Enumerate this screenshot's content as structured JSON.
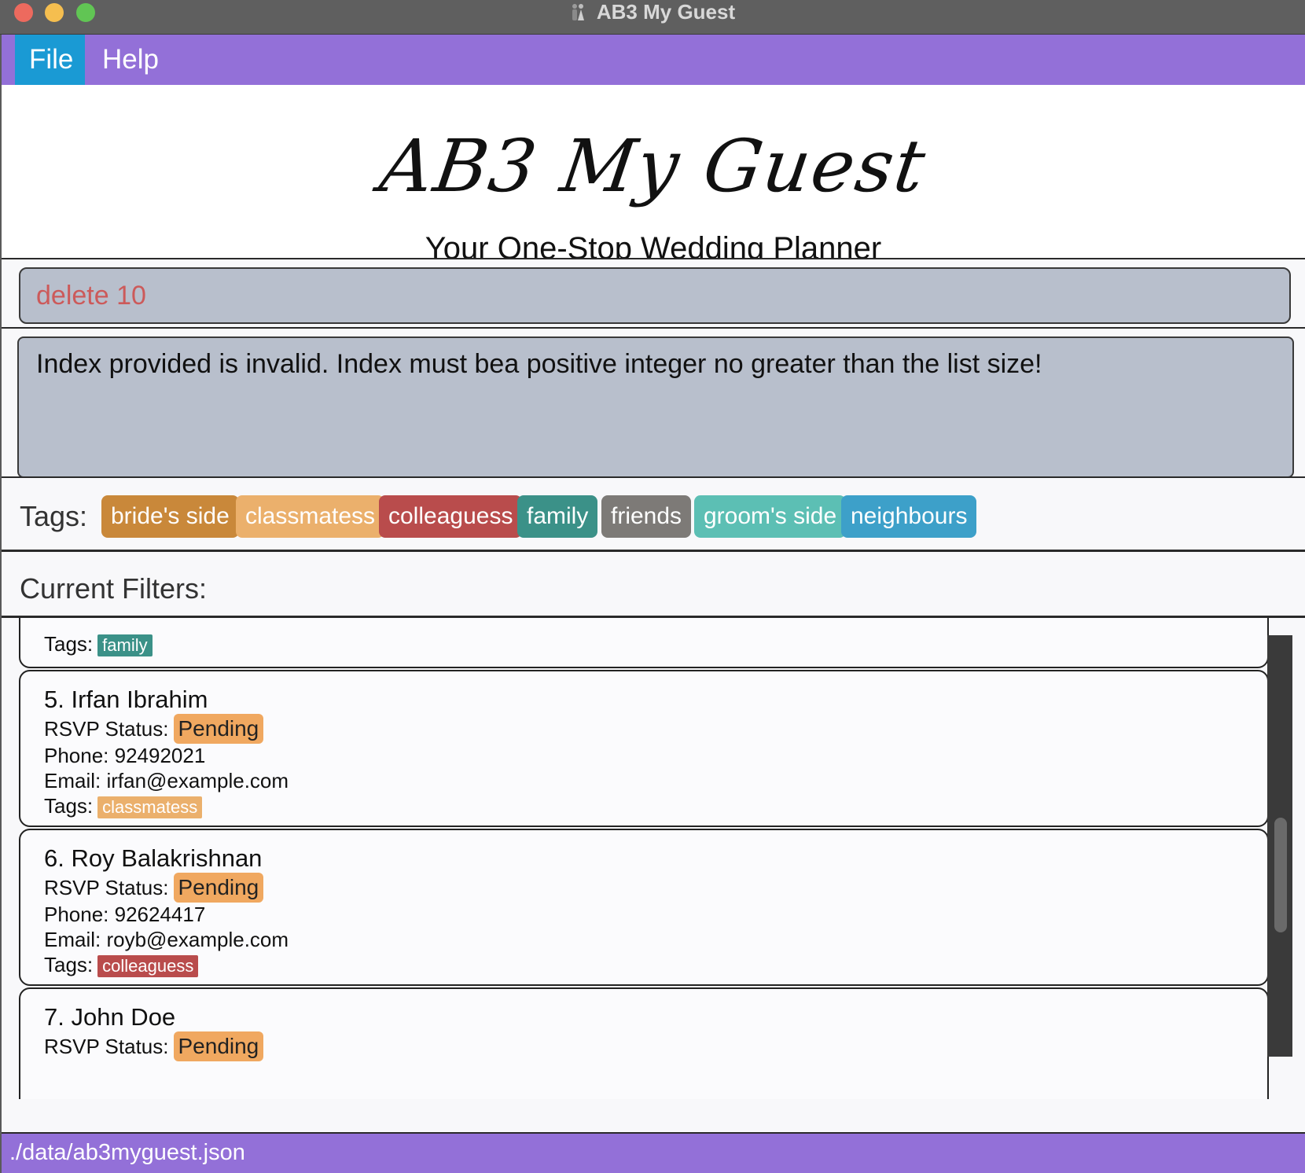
{
  "window": {
    "title": "AB3 My Guest"
  },
  "menu": {
    "file": "File",
    "help": "Help"
  },
  "header": {
    "logo": "AB3 My Guest",
    "subtitle": "Your One-Stop Wedding Planner"
  },
  "command": {
    "value": "delete 10"
  },
  "result": {
    "message": "Index provided is invalid. Index must bea positive integer no greater than the list size!"
  },
  "tags": {
    "label": "Tags:",
    "items": [
      {
        "label": "bride's side",
        "color": "#c9883a"
      },
      {
        "label": "classmatess",
        "color": "#ebb06c"
      },
      {
        "label": "colleaguess",
        "color": "#b94c4c"
      },
      {
        "label": "family",
        "color": "#3b9188"
      },
      {
        "label": "friends",
        "color": "#7d7a77"
      },
      {
        "label": "groom's side",
        "color": "#5cbfb4"
      },
      {
        "label": "neighbours",
        "color": "#3da0c9"
      }
    ]
  },
  "filters": {
    "label": "Current Filters:"
  },
  "guests": [
    {
      "tags_label": "Tags:",
      "tag": "family",
      "tag_color": "#3b9188"
    },
    {
      "name": "5. Irfan Ibrahim",
      "rsvp_label": "RSVP Status:",
      "rsvp": "Pending",
      "phone": "Phone: 92492021",
      "email": "Email: irfan@example.com",
      "tags_label": "Tags:",
      "tag": "classmatess",
      "tag_color": "#ebb06c"
    },
    {
      "name": "6. Roy Balakrishnan",
      "rsvp_label": "RSVP Status:",
      "rsvp": "Pending",
      "phone": "Phone: 92624417",
      "email": "Email: royb@example.com",
      "tags_label": "Tags:",
      "tag": "colleaguess",
      "tag_color": "#b94c4c"
    },
    {
      "name": "7. John Doe",
      "rsvp_label": "RSVP Status:",
      "rsvp": "Pending"
    }
  ],
  "status": {
    "file_path": "./data/ab3myguest.json"
  }
}
